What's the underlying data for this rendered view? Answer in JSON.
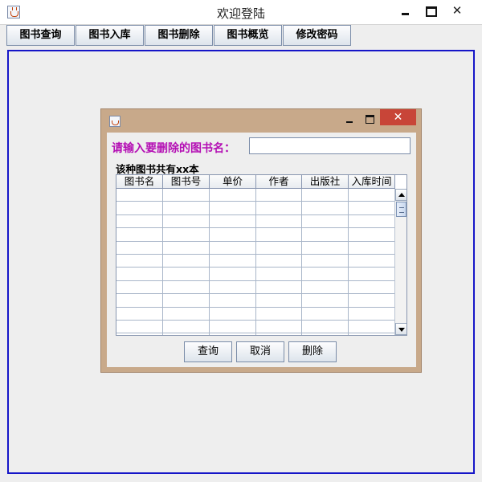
{
  "window": {
    "title": "欢迎登陆"
  },
  "toolbar": {
    "buttons": [
      {
        "label": "图书查询"
      },
      {
        "label": "图书入库"
      },
      {
        "label": "图书删除"
      },
      {
        "label": "图书概览"
      },
      {
        "label": "修改密码"
      }
    ]
  },
  "dialog": {
    "prompt": "请输入要删除的图书名：",
    "input_value": "",
    "count_label": "该种图书共有xx本",
    "table": {
      "columns": [
        "图书名",
        "图书号",
        "单价",
        "作者",
        "出版社",
        "入库时间"
      ],
      "rows": []
    },
    "buttons": {
      "query": "查询",
      "cancel": "取消",
      "delete": "删除"
    },
    "close_glyph": "✕"
  },
  "colors": {
    "prompt": "#b40fb4",
    "desktop_border": "#1515c8",
    "frame": "#c8a98a",
    "close_button": "#c84538"
  }
}
